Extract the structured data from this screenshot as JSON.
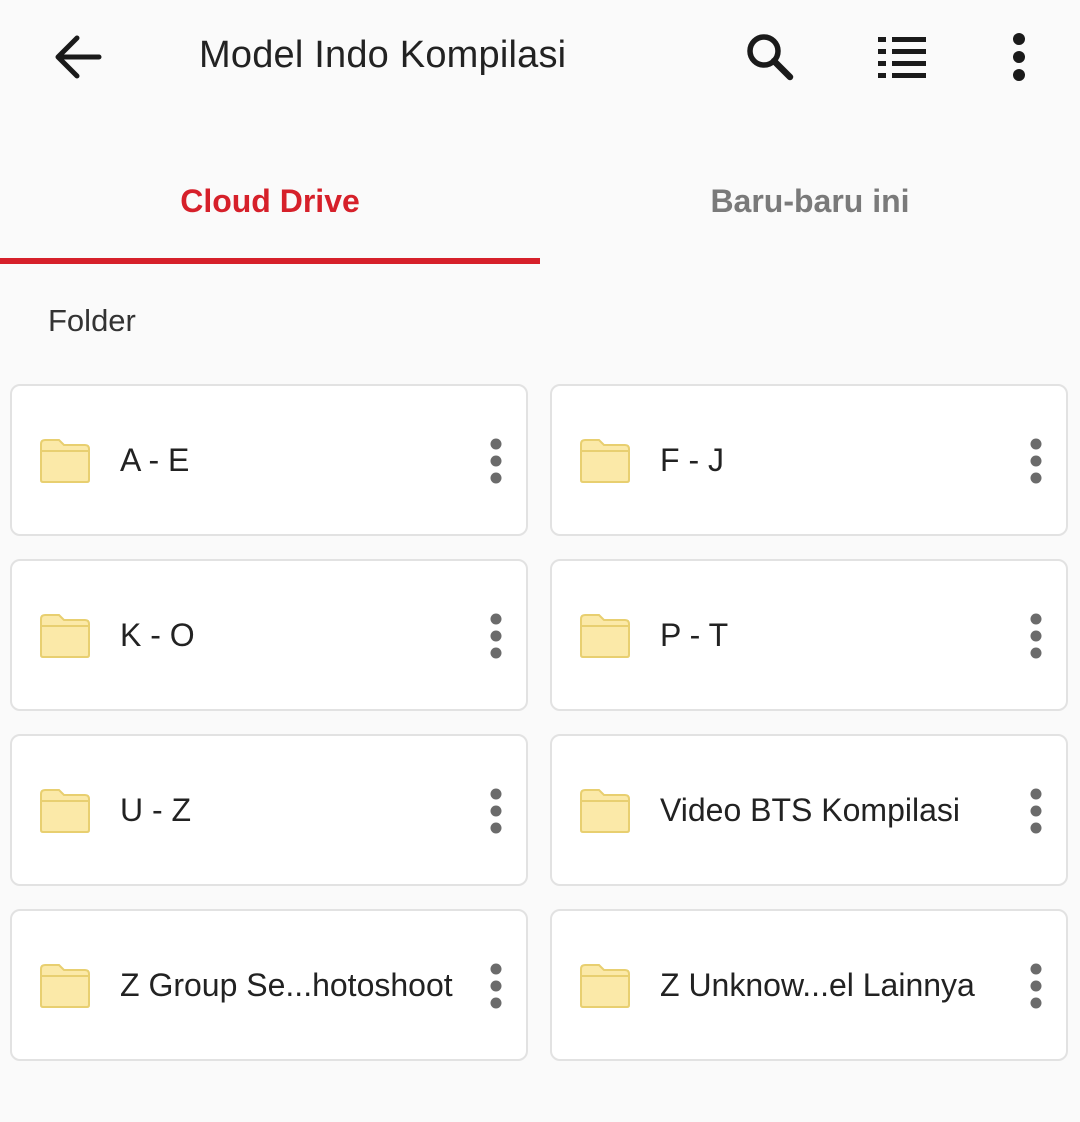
{
  "header": {
    "title": "Model Indo Kompilasi",
    "icons": {
      "back": "arrow-back-icon",
      "search": "search-icon",
      "view_toggle": "list-view-icon",
      "more": "more-vertical-icon"
    }
  },
  "tabs": [
    {
      "label": "Cloud Drive",
      "active": true
    },
    {
      "label": "Baru-baru ini",
      "active": false
    }
  ],
  "section": {
    "label": "Folder"
  },
  "folders": [
    {
      "name": "A - E"
    },
    {
      "name": "F - J"
    },
    {
      "name": "K - O"
    },
    {
      "name": "P - T"
    },
    {
      "name": "U - Z"
    },
    {
      "name": "Video BTS Kompilasi"
    },
    {
      "name": "Z Group Se...hotoshoot"
    },
    {
      "name": "Z Unknow...el Lainnya"
    }
  ],
  "colors": {
    "accent": "#d6202a",
    "inactive_tab": "#7a7a7a",
    "folder_fill": "#fbe9a8",
    "folder_stroke": "#e8cf70",
    "dots": "#6b6b6b"
  }
}
